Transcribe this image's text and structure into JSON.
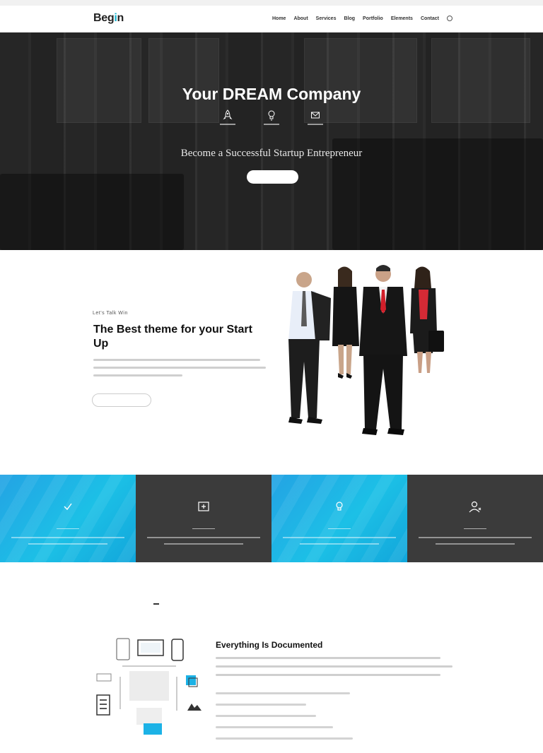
{
  "topbar": {
    "left_text": "",
    "right_text": ""
  },
  "brand": {
    "logo_prefix": "Beg",
    "logo_accent": "i",
    "logo_suffix": "n"
  },
  "nav": {
    "items": [
      "Home",
      "About",
      "Services",
      "Blog",
      "Portfolio",
      "Elements",
      "Contact"
    ]
  },
  "hero": {
    "title": "Your DREAM Company",
    "subtitle": "Become a Successful Startup Entrepreneur",
    "button": "",
    "icons": [
      "rocket-icon",
      "bulb-icon",
      "envelope-icon"
    ]
  },
  "about": {
    "eyebrow": "Let's Talk Win",
    "title": "The Best theme for your Start Up",
    "button": ""
  },
  "features": [
    {
      "title": "",
      "icon": "check-icon",
      "theme": "blue"
    },
    {
      "title": "",
      "icon": "plus-box-icon",
      "theme": "dark"
    },
    {
      "title": "",
      "icon": "bulb-icon",
      "theme": "blue"
    },
    {
      "title": "",
      "icon": "user-icon",
      "theme": "dark"
    }
  ],
  "tabs": {
    "items": [
      "",
      "",
      ""
    ],
    "active_index": 0
  },
  "documented": {
    "title": "Everything Is Documented"
  },
  "colors": {
    "accent": "#0fb3cf",
    "feature_blue": "#1cb2e6",
    "feature_dark": "#3b3b3b"
  }
}
